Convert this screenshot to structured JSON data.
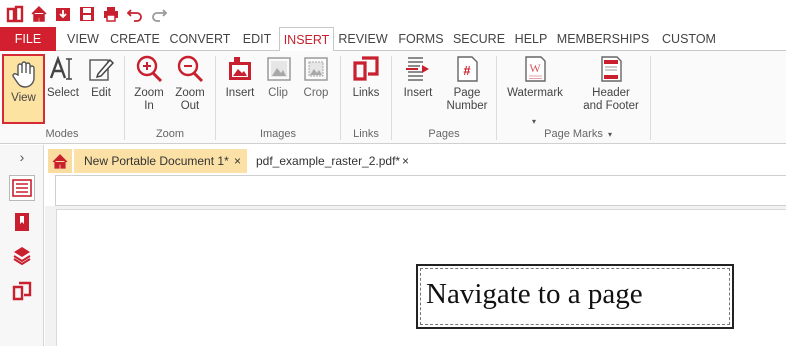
{
  "quick_access": {
    "icons": [
      "app-logo-icon",
      "home-icon",
      "download-icon",
      "save-icon",
      "print-icon",
      "undo-icon",
      "redo-icon"
    ]
  },
  "menu": {
    "file": "FILE",
    "items": [
      "VIEW",
      "CREATE",
      "CONVERT",
      "EDIT",
      "INSERT",
      "REVIEW",
      "FORMS",
      "SECURE",
      "HELP",
      "MEMBERSHIPS",
      "CUSTOM"
    ],
    "active": "INSERT"
  },
  "ribbon": {
    "modes": {
      "label": "Modes",
      "view": "View",
      "select": "Select",
      "edit": "Edit"
    },
    "zoom": {
      "label": "Zoom",
      "zoom_in": "Zoom\nIn",
      "zoom_out": "Zoom\nOut"
    },
    "images": {
      "label": "Images",
      "insert": "Insert",
      "clip": "Clip",
      "crop": "Crop"
    },
    "links": {
      "label": "Links",
      "links": "Links"
    },
    "pages": {
      "label": "Pages",
      "insert": "Insert",
      "page_number": "Page\nNumber"
    },
    "page_marks": {
      "label": "Page Marks",
      "watermark": "Watermark",
      "header_footer": "Header\nand Footer"
    }
  },
  "tabs": {
    "doc1": "New Portable Document 1*",
    "doc2": "pdf_example_raster_2.pdf*",
    "close": "×"
  },
  "document": {
    "text": "Navigate to a page"
  },
  "colors": {
    "brand": "#d3202f",
    "active_tab": "#fbe1a6"
  }
}
